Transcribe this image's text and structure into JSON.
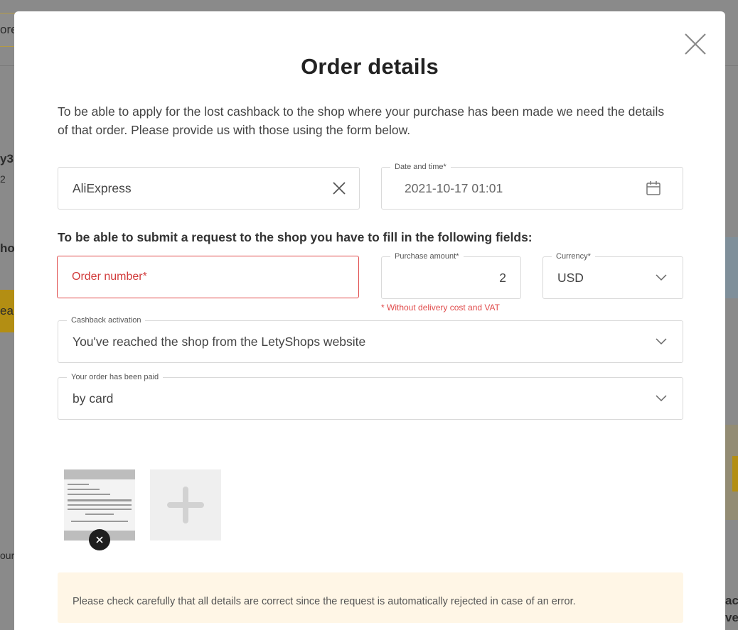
{
  "background": {
    "fragments": [
      "ore",
      "y3",
      "2",
      "ho",
      "ea",
      "our",
      "ac",
      "ve"
    ]
  },
  "modal": {
    "title": "Order details",
    "intro": "To be able to apply for the lost cashback to the shop where your purchase has been made we need the details of that order. Please provide us with those using the form below.",
    "shop_field": {
      "value": "AliExpress"
    },
    "date_field": {
      "label": "Date and time*",
      "value": "2021-10-17 01:01"
    },
    "subheading": "To be able to submit a request to the shop you have to fill in the following fields:",
    "order_number": {
      "placeholder": "Order number*"
    },
    "purchase_amount": {
      "label": "Purchase amount*",
      "value": "2"
    },
    "currency": {
      "label": "Currency*",
      "value": "USD"
    },
    "amount_hint": "* Without delivery cost and VAT",
    "activation": {
      "label": "Cashback activation",
      "value": "You've reached the shop from the LetyShops website"
    },
    "paid": {
      "label": "Your order has been paid",
      "value": "by card"
    },
    "notice": "Please check carefully that all details are correct since the request is automatically rejected in case of an error."
  },
  "icons": {
    "close": "close-icon",
    "clear": "clear-icon",
    "calendar": "calendar-icon",
    "chevron": "chevron-down-icon",
    "plus": "plus-icon"
  },
  "colors": {
    "error": "#e04b4b",
    "notice_bg": "#fff6e6",
    "accent_yellow": "#b38e13"
  }
}
